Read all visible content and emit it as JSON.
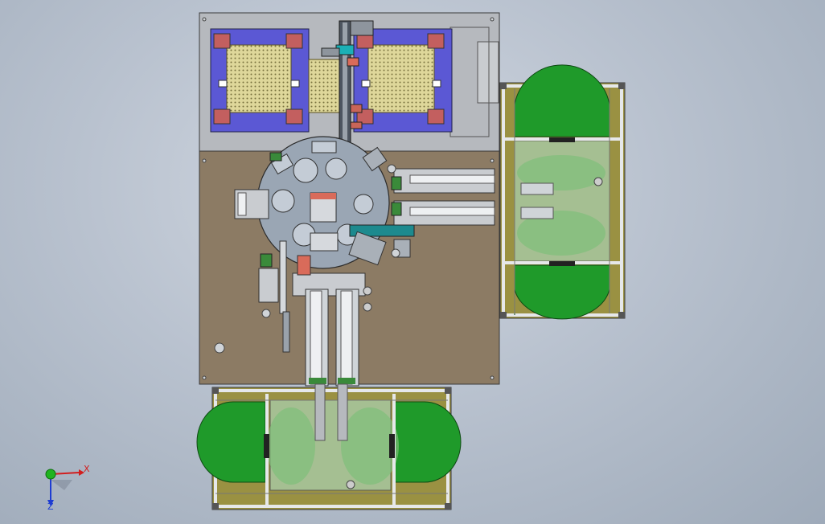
{
  "colors": {
    "background": "#b9c2cf",
    "base_plate": "#8c7b64",
    "top_plate": "#b6b9be",
    "purple_fixture": "#5b58d4",
    "tray_yellow": "#ded79a",
    "bin_green": "#1f9a2a",
    "olive_panel": "#9a9142",
    "frame": "#d3d6da",
    "outline": "#3a3a3a",
    "rotary_table": "#9aa6b4",
    "axis_x": "#d21e1e",
    "axis_y": "#1fb41f",
    "axis_z": "#1e3cd2"
  },
  "triad": {
    "x_label": "X",
    "z_label": "Z"
  }
}
